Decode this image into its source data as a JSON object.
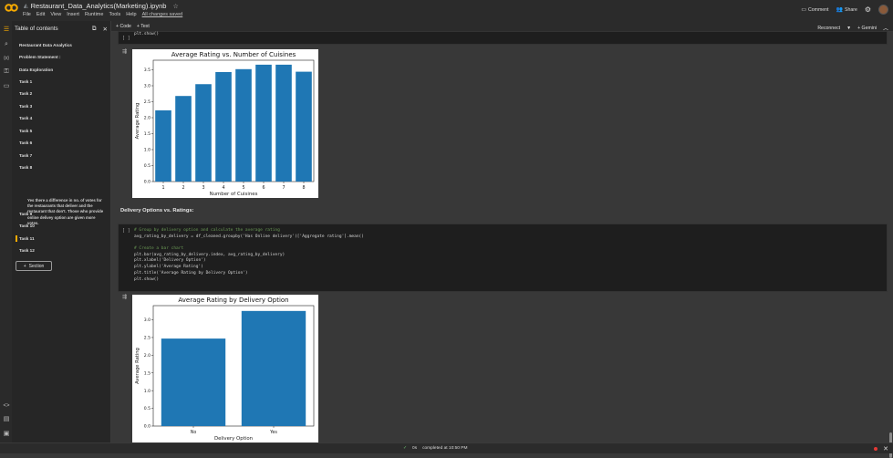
{
  "app": {
    "file_name": "Restaurant_Data_Analytics(Marketing).ipynb",
    "menu": [
      "File",
      "Edit",
      "View",
      "Insert",
      "Runtime",
      "Tools",
      "Help"
    ],
    "saved_status": "All changes saved",
    "comment_label": "Comment",
    "share_label": "Share"
  },
  "toolbar": {
    "code_label": "+ Code",
    "text_label": "+ Text",
    "reconnect_label": "Reconnect",
    "gemini_label": "+ Gemini"
  },
  "sidebar": {
    "title": "Table of contents",
    "items": [
      "Restaurant Data Analytics",
      "Problem Statement :",
      "Data Exploration",
      "Task 1",
      "Task 2",
      "Task 3",
      "Task 4",
      "Task 5",
      "Task 6",
      "Task 7",
      "Task 8",
      "Task 9",
      "Task 10",
      "Task 11",
      "Task 12"
    ],
    "sub_item": "Yes there a difference in no. of votes for the restaurants that deliver and the restaurant that don't. Those who provide online delivey option are given more votes.",
    "section_button": "Section"
  },
  "cells": {
    "top_code_tail": "plt.show()",
    "top_bracket": "[ ]",
    "markdown_heading": "Delivery Options vs. Ratings:",
    "code_bracket": "[ ]",
    "code_lines": [
      "# Group by delivery option and calculate the average rating",
      "avg_rating_by_delivery = df_cleaned.groupby('Has Online delivery')['Aggregate rating'].mean()",
      "",
      "# Create a bar chart",
      "plt.bar(avg_rating_by_delivery.index, avg_rating_by_delivery)",
      "plt.xlabel('Delivery Option')",
      "plt.ylabel('Average Rating')",
      "plt.title('Average Rating by Delivery Option')",
      "plt.show()"
    ]
  },
  "status": {
    "check": "✓",
    "elapsed": "0s",
    "completed": "completed at 10:50 PM"
  },
  "colors": {
    "bar": "#1f77b4",
    "accent": "#f9ab00"
  },
  "chart_data": [
    {
      "type": "bar",
      "title": "Average Rating vs. Number of Cuisines",
      "xlabel": "Number of Cuisines",
      "ylabel": "Average Rating",
      "categories": [
        "1",
        "2",
        "3",
        "4",
        "5",
        "6",
        "7",
        "8"
      ],
      "values": [
        2.23,
        2.68,
        3.05,
        3.43,
        3.52,
        3.66,
        3.66,
        3.44
      ],
      "ylim": [
        0,
        3.8
      ],
      "yticks": [
        0.0,
        0.5,
        1.0,
        1.5,
        2.0,
        2.5,
        3.0,
        3.5
      ],
      "grid": false
    },
    {
      "type": "bar",
      "title": "Average Rating by Delivery Option",
      "xlabel": "Delivery Option",
      "ylabel": "Average Rating",
      "categories": [
        "No",
        "Yes"
      ],
      "values": [
        2.47,
        3.25
      ],
      "ylim": [
        0,
        3.4
      ],
      "yticks": [
        0.0,
        0.5,
        1.0,
        1.5,
        2.0,
        2.5,
        3.0
      ],
      "grid": false
    }
  ]
}
